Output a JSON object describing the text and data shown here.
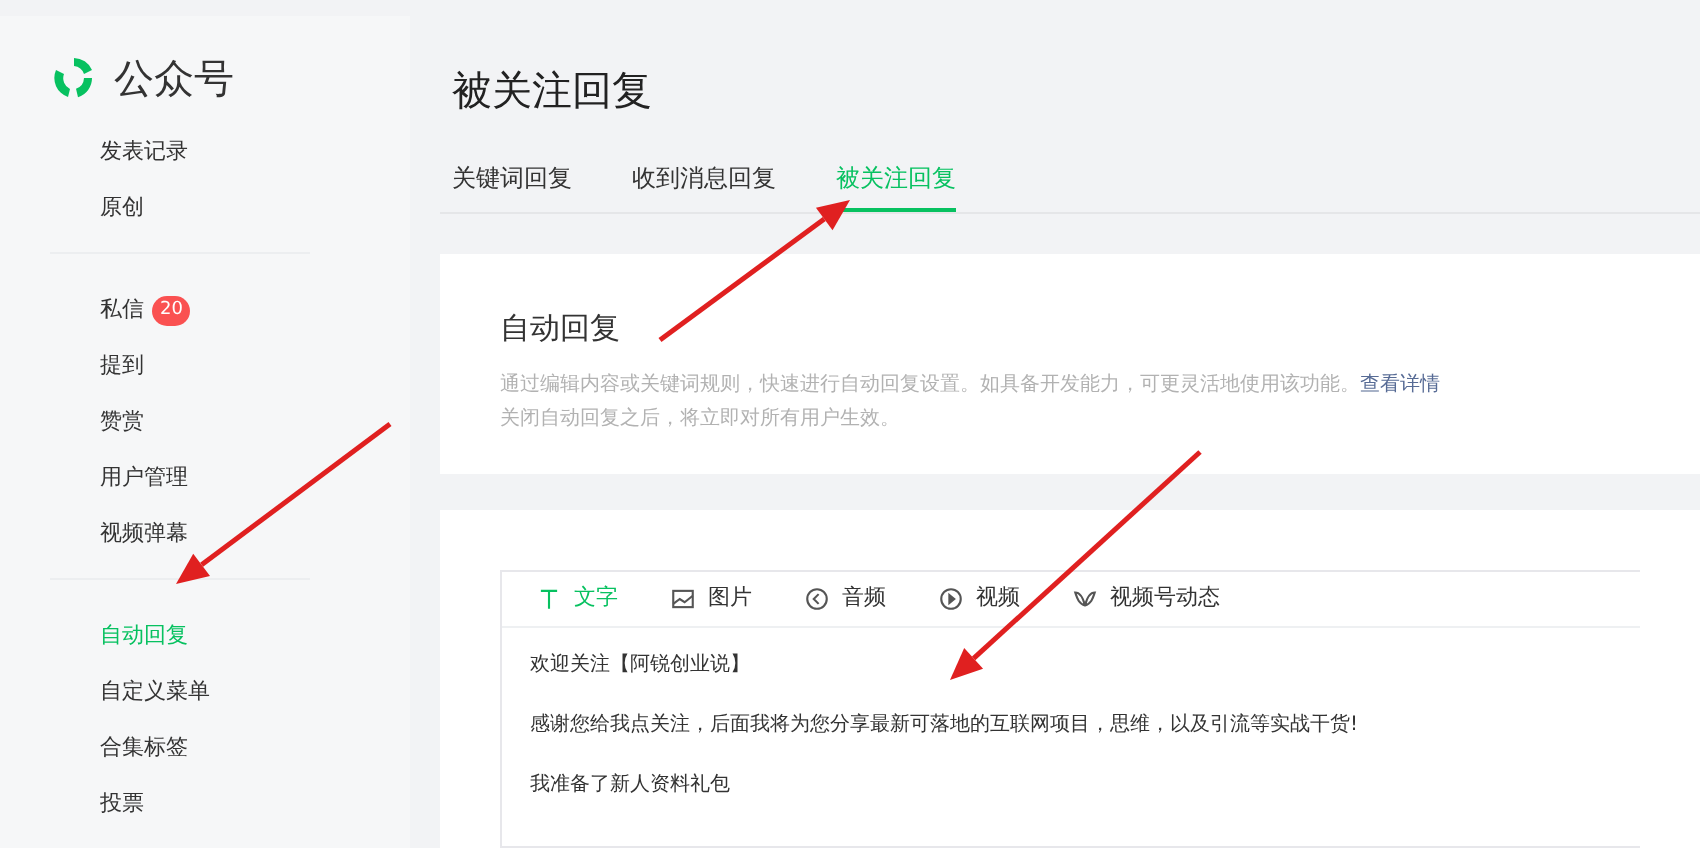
{
  "logo": {
    "text": "公众号"
  },
  "sidebar": {
    "sections": [
      {
        "items": [
          {
            "label": "发表记录",
            "selected": false
          },
          {
            "label": "原创",
            "selected": false
          }
        ]
      },
      {
        "items": [
          {
            "label": "私信",
            "selected": false,
            "badge": "20"
          },
          {
            "label": "提到",
            "selected": false
          },
          {
            "label": "赞赏",
            "selected": false
          },
          {
            "label": "用户管理",
            "selected": false
          },
          {
            "label": "视频弹幕",
            "selected": false
          }
        ]
      },
      {
        "items": [
          {
            "label": "自动回复",
            "selected": true
          },
          {
            "label": "自定义菜单",
            "selected": false
          },
          {
            "label": "合集标签",
            "selected": false
          },
          {
            "label": "投票",
            "selected": false
          }
        ]
      }
    ]
  },
  "page_title": "被关注回复",
  "tabs": [
    {
      "label": "关键词回复",
      "selected": false
    },
    {
      "label": "收到消息回复",
      "selected": false
    },
    {
      "label": "被关注回复",
      "selected": true
    }
  ],
  "info_card": {
    "title": "自动回复",
    "description": "通过编辑内容或关键词规则，快速进行自动回复设置。如具备开发能力，可更灵活地使用该功能。",
    "link": "查看详情",
    "note": "关闭自动回复之后，将立即对所有用户生效。"
  },
  "editor": {
    "types": [
      {
        "kind": "text",
        "label": "文字",
        "selected": true
      },
      {
        "kind": "image",
        "label": "图片",
        "selected": false
      },
      {
        "kind": "audio",
        "label": "音频",
        "selected": false
      },
      {
        "kind": "video",
        "label": "视频",
        "selected": false
      },
      {
        "kind": "channels",
        "label": "视频号动态",
        "selected": false
      }
    ],
    "lines": [
      "欢迎关注【阿锐创业说】",
      "感谢您给我点关注，后面我将为您分享最新可落地的互联网项目，思维，以及引流等实战干货!",
      "我准备了新人资料礼包"
    ]
  },
  "annotations": [
    {
      "kind": "arrow"
    },
    {
      "kind": "arrow"
    },
    {
      "kind": "arrow"
    }
  ]
}
